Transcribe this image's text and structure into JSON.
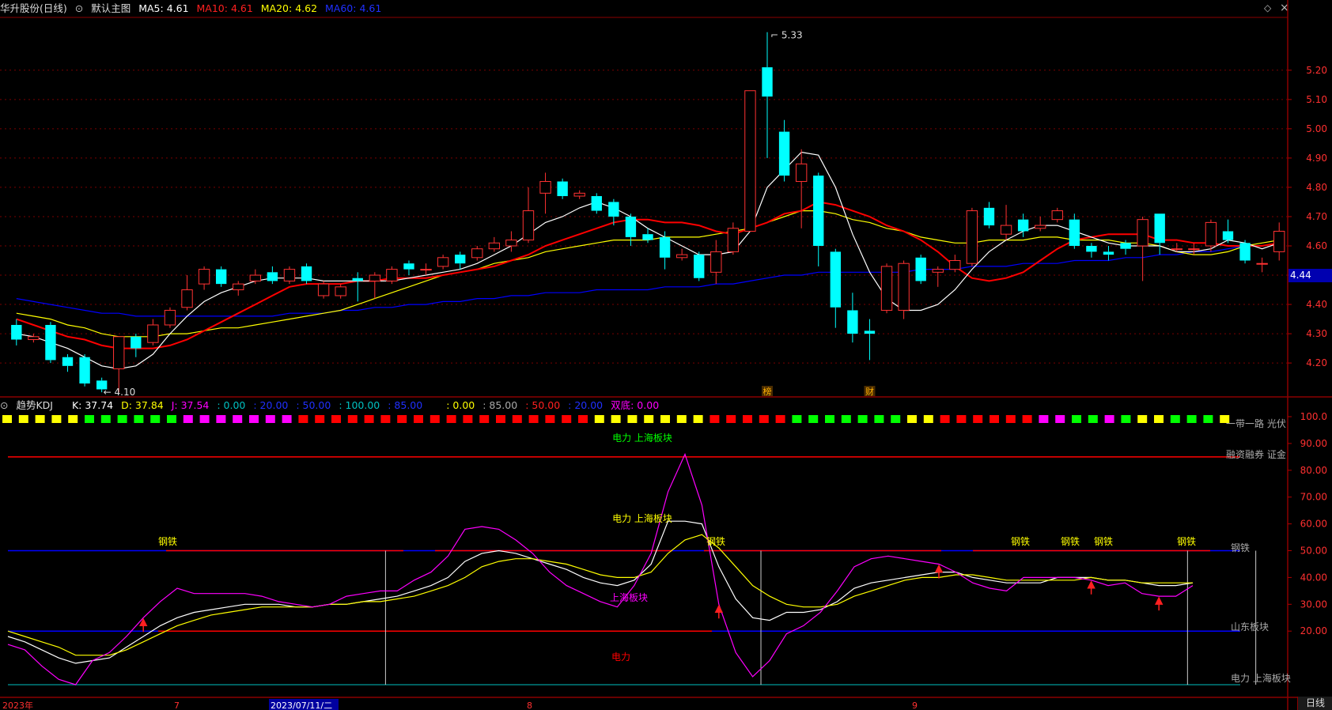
{
  "header": {
    "stock_name": "华升股份(日线)",
    "template_label": "默认主图",
    "ma5": "MA5: 4.61",
    "ma10": "MA10: 4.61",
    "ma20": "MA20: 4.62",
    "ma60": "MA60: 4.61"
  },
  "kdj_header": {
    "name": "趋势KDJ",
    "k": "K: 37.74",
    "d": "D: 37.84",
    "j": "J: 37.54",
    "v1": ": 0.00",
    "v2": ": 20.00",
    "v3": ": 50.00",
    "v4": ": 100.00",
    "v5": ": 85.00",
    "v6": ": 0.00",
    "v7": ": 85.00",
    "v8": ": 50.00",
    "v9": ": 20.00",
    "v10": "双底: 0.00"
  },
  "colors": {
    "up": "#ff3232",
    "down": "#00ffff",
    "ma5": "#ffffff",
    "ma10": "#ff0000",
    "ma20": "#ffff00",
    "ma60": "#0000ff",
    "k": "#ffffff",
    "d": "#ffff00",
    "j": "#ff00ff"
  },
  "price_badge": "4.44",
  "period_tab": "日线",
  "controls": {
    "diamond": "◇",
    "close": "×"
  },
  "chart_data": [
    {
      "type": "candlestick",
      "title": "华升股份(日线)",
      "y_ticks": [
        4.2,
        4.3,
        4.4,
        4.5,
        4.6,
        4.7,
        4.8,
        4.9,
        5.0,
        5.1,
        5.2
      ],
      "y_tick_labels": [
        "4.20",
        "4.30",
        "4.40",
        "4.50",
        "4.60",
        "4.70",
        "4.80",
        "4.90",
        "5.00",
        "5.10",
        "5.20"
      ],
      "ylim": [
        4.095,
        5.375
      ],
      "high_label": "5.33",
      "low_label": "4.10",
      "markers": [
        {
          "text": "榜",
          "index": 44
        },
        {
          "text": "财",
          "index": 50
        }
      ],
      "candles": [
        [
          4.33,
          4.28,
          4.35,
          4.26
        ],
        [
          4.28,
          4.29,
          4.3,
          4.27
        ],
        [
          4.33,
          4.21,
          4.34,
          4.2
        ],
        [
          4.22,
          4.19,
          4.23,
          4.17
        ],
        [
          4.22,
          4.13,
          4.23,
          4.12
        ],
        [
          4.14,
          4.11,
          4.15,
          4.1
        ],
        [
          4.18,
          4.29,
          4.29,
          4.1
        ],
        [
          4.29,
          4.25,
          4.3,
          4.22
        ],
        [
          4.27,
          4.33,
          4.35,
          4.26
        ],
        [
          4.33,
          4.38,
          4.39,
          4.32
        ],
        [
          4.39,
          4.45,
          4.5,
          4.38
        ],
        [
          4.47,
          4.52,
          4.53,
          4.45
        ],
        [
          4.52,
          4.47,
          4.53,
          4.46
        ],
        [
          4.45,
          4.47,
          4.48,
          4.43
        ],
        [
          4.48,
          4.5,
          4.52,
          4.47
        ],
        [
          4.51,
          4.48,
          4.53,
          4.47
        ],
        [
          4.48,
          4.52,
          4.53,
          4.47
        ],
        [
          4.53,
          4.48,
          4.54,
          4.47
        ],
        [
          4.43,
          4.47,
          4.48,
          4.42
        ],
        [
          4.43,
          4.46,
          4.47,
          4.42
        ],
        [
          4.49,
          4.48,
          4.51,
          4.41
        ],
        [
          4.48,
          4.5,
          4.51,
          4.42
        ],
        [
          4.48,
          4.52,
          4.53,
          4.47
        ],
        [
          4.54,
          4.52,
          4.55,
          4.5
        ],
        [
          4.52,
          4.52,
          4.54,
          4.5
        ],
        [
          4.53,
          4.56,
          4.57,
          4.52
        ],
        [
          4.57,
          4.54,
          4.58,
          4.52
        ],
        [
          4.56,
          4.59,
          4.6,
          4.55
        ],
        [
          4.59,
          4.61,
          4.63,
          4.58
        ],
        [
          4.6,
          4.62,
          4.65,
          4.58
        ],
        [
          4.62,
          4.72,
          4.8,
          4.61
        ],
        [
          4.78,
          4.82,
          4.85,
          4.71
        ],
        [
          4.82,
          4.77,
          4.83,
          4.76
        ],
        [
          4.77,
          4.78,
          4.79,
          4.76
        ],
        [
          4.77,
          4.72,
          4.78,
          4.71
        ],
        [
          4.75,
          4.7,
          4.76,
          4.67
        ],
        [
          4.7,
          4.63,
          4.71,
          4.6
        ],
        [
          4.64,
          4.62,
          4.66,
          4.61
        ],
        [
          4.63,
          4.56,
          4.65,
          4.52
        ],
        [
          4.56,
          4.57,
          4.59,
          4.55
        ],
        [
          4.57,
          4.49,
          4.58,
          4.48
        ],
        [
          4.51,
          4.58,
          4.62,
          4.47
        ],
        [
          4.58,
          4.66,
          4.68,
          4.57
        ],
        [
          4.65,
          5.13,
          5.13,
          4.65
        ],
        [
          5.21,
          5.11,
          5.33,
          4.9
        ],
        [
          4.99,
          4.84,
          5.03,
          4.82
        ],
        [
          4.82,
          4.88,
          4.93,
          4.66
        ],
        [
          4.84,
          4.6,
          4.85,
          4.53
        ],
        [
          4.58,
          4.39,
          4.59,
          4.32
        ],
        [
          4.38,
          4.3,
          4.44,
          4.27
        ],
        [
          4.31,
          4.3,
          4.35,
          4.21
        ],
        [
          4.38,
          4.53,
          4.54,
          4.37
        ],
        [
          4.38,
          4.54,
          4.55,
          4.35
        ],
        [
          4.56,
          4.48,
          4.57,
          4.47
        ],
        [
          4.51,
          4.52,
          4.53,
          4.46
        ],
        [
          4.52,
          4.55,
          4.57,
          4.51
        ],
        [
          4.54,
          4.72,
          4.73,
          4.53
        ],
        [
          4.73,
          4.67,
          4.75,
          4.66
        ],
        [
          4.64,
          4.67,
          4.74,
          4.62
        ],
        [
          4.69,
          4.65,
          4.71,
          4.63
        ],
        [
          4.66,
          4.67,
          4.7,
          4.65
        ],
        [
          4.69,
          4.72,
          4.73,
          4.68
        ],
        [
          4.69,
          4.6,
          4.71,
          4.59
        ],
        [
          4.6,
          4.58,
          4.61,
          4.56
        ],
        [
          4.58,
          4.57,
          4.6,
          4.55
        ],
        [
          4.61,
          4.59,
          4.62,
          4.57
        ],
        [
          4.6,
          4.69,
          4.7,
          4.48
        ],
        [
          4.71,
          4.61,
          4.71,
          4.57
        ],
        [
          4.59,
          4.59,
          4.61,
          4.58
        ],
        [
          4.59,
          4.59,
          4.61,
          4.57
        ],
        [
          4.6,
          4.68,
          4.69,
          4.58
        ],
        [
          4.65,
          4.62,
          4.69,
          4.61
        ],
        [
          4.61,
          4.55,
          4.62,
          4.54
        ],
        [
          4.54,
          4.54,
          4.56,
          4.51
        ],
        [
          4.58,
          4.65,
          4.68,
          4.55
        ]
      ],
      "ma5": [
        4.3,
        4.29,
        4.27,
        4.25,
        4.22,
        4.19,
        4.18,
        4.19,
        4.23,
        4.3,
        4.36,
        4.41,
        4.44,
        4.46,
        4.48,
        4.49,
        4.49,
        4.49,
        4.48,
        4.48,
        4.48,
        4.48,
        4.48,
        4.49,
        4.5,
        4.51,
        4.52,
        4.54,
        4.57,
        4.6,
        4.64,
        4.68,
        4.7,
        4.73,
        4.75,
        4.73,
        4.7,
        4.66,
        4.63,
        4.6,
        4.57,
        4.57,
        4.58,
        4.65,
        4.8,
        4.86,
        4.92,
        4.91,
        4.8,
        4.64,
        4.51,
        4.42,
        4.38,
        4.38,
        4.4,
        4.45,
        4.52,
        4.58,
        4.62,
        4.65,
        4.67,
        4.67,
        4.65,
        4.63,
        4.61,
        4.6,
        4.6,
        4.6,
        4.58,
        4.58,
        4.59,
        4.62,
        4.61,
        4.59,
        4.61
      ],
      "ma10": [
        4.35,
        4.33,
        4.31,
        4.29,
        4.28,
        4.26,
        4.25,
        4.25,
        4.25,
        4.26,
        4.28,
        4.31,
        4.34,
        4.37,
        4.4,
        4.43,
        4.46,
        4.47,
        4.47,
        4.47,
        4.48,
        4.48,
        4.49,
        4.49,
        4.49,
        4.5,
        4.51,
        4.52,
        4.53,
        4.55,
        4.57,
        4.6,
        4.62,
        4.64,
        4.66,
        4.68,
        4.69,
        4.69,
        4.68,
        4.68,
        4.67,
        4.65,
        4.64,
        4.66,
        4.68,
        4.71,
        4.72,
        4.75,
        4.74,
        4.72,
        4.7,
        4.67,
        4.65,
        4.62,
        4.58,
        4.53,
        4.49,
        4.48,
        4.49,
        4.51,
        4.55,
        4.59,
        4.62,
        4.63,
        4.64,
        4.64,
        4.64,
        4.62,
        4.62,
        4.61,
        4.61,
        4.6,
        4.6,
        4.6,
        4.61
      ],
      "ma20": [
        4.37,
        4.36,
        4.35,
        4.33,
        4.32,
        4.3,
        4.29,
        4.29,
        4.29,
        4.3,
        4.3,
        4.31,
        4.32,
        4.32,
        4.33,
        4.34,
        4.35,
        4.36,
        4.37,
        4.38,
        4.4,
        4.42,
        4.44,
        4.46,
        4.48,
        4.5,
        4.51,
        4.52,
        4.54,
        4.55,
        4.56,
        4.58,
        4.59,
        4.6,
        4.61,
        4.62,
        4.62,
        4.62,
        4.63,
        4.63,
        4.63,
        4.64,
        4.65,
        4.66,
        4.68,
        4.7,
        4.72,
        4.72,
        4.71,
        4.69,
        4.68,
        4.66,
        4.65,
        4.63,
        4.62,
        4.61,
        4.61,
        4.62,
        4.62,
        4.62,
        4.63,
        4.63,
        4.62,
        4.62,
        4.62,
        4.61,
        4.61,
        4.6,
        4.58,
        4.57,
        4.57,
        4.58,
        4.6,
        4.61,
        4.62
      ],
      "ma60": [
        4.42,
        4.41,
        4.4,
        4.39,
        4.38,
        4.37,
        4.37,
        4.36,
        4.36,
        4.36,
        4.36,
        4.36,
        4.36,
        4.36,
        4.36,
        4.36,
        4.37,
        4.37,
        4.37,
        4.38,
        4.38,
        4.39,
        4.39,
        4.4,
        4.4,
        4.41,
        4.41,
        4.42,
        4.42,
        4.43,
        4.43,
        4.44,
        4.44,
        4.44,
        4.45,
        4.45,
        4.45,
        4.45,
        4.46,
        4.46,
        4.46,
        4.47,
        4.47,
        4.48,
        4.49,
        4.5,
        4.5,
        4.51,
        4.51,
        4.51,
        4.51,
        4.51,
        4.51,
        4.52,
        4.52,
        4.52,
        4.53,
        4.53,
        4.53,
        4.54,
        4.54,
        4.54,
        4.55,
        4.55,
        4.55,
        4.56,
        4.56,
        4.57,
        4.57,
        4.58,
        4.58,
        4.59,
        4.6,
        4.6,
        4.61
      ]
    },
    {
      "type": "line",
      "title": "趋势KDJ",
      "y_ticks": [
        20,
        30,
        40,
        50,
        60,
        70,
        80,
        90,
        100
      ],
      "y_tick_labels": [
        "20.00",
        "30.00",
        "40.00",
        "50.00",
        "60.00",
        "70.00",
        "80.00",
        "90.00",
        "100.0"
      ],
      "ylim": [
        0,
        100
      ],
      "series": [
        {
          "name": "K",
          "values": [
            18,
            16,
            13,
            10,
            8,
            9,
            10,
            14,
            18,
            22,
            25,
            27,
            28,
            29,
            30,
            30,
            30,
            29,
            29,
            30,
            30,
            31,
            32,
            33,
            35,
            37,
            40,
            46,
            49,
            50,
            49,
            47,
            45,
            43,
            40,
            38,
            37,
            39,
            45,
            61,
            61,
            60,
            44,
            32,
            25,
            24,
            27,
            27,
            28,
            31,
            36,
            38,
            39,
            40,
            41,
            42,
            42,
            40,
            39,
            38,
            38,
            38,
            40,
            40,
            40,
            39,
            39,
            38,
            37,
            37,
            38
          ]
        },
        {
          "name": "D",
          "values": [
            20,
            18,
            16,
            14,
            11,
            11,
            11,
            13,
            16,
            19,
            22,
            24,
            26,
            27,
            28,
            29,
            29,
            29,
            29,
            30,
            30,
            31,
            31,
            32,
            33,
            35,
            37,
            40,
            44,
            46,
            47,
            47,
            46,
            45,
            43,
            41,
            40,
            40,
            42,
            49,
            54,
            56,
            51,
            44,
            37,
            33,
            30,
            29,
            29,
            30,
            33,
            35,
            37,
            39,
            40,
            40,
            41,
            41,
            40,
            39,
            39,
            39,
            39,
            39,
            40,
            39,
            39,
            38,
            38,
            38,
            38
          ]
        },
        {
          "name": "J",
          "values": [
            15,
            13,
            7,
            2,
            0,
            9,
            12,
            18,
            25,
            31,
            36,
            34,
            34,
            34,
            34,
            33,
            31,
            30,
            29,
            30,
            33,
            34,
            35,
            35,
            39,
            42,
            48,
            58,
            59,
            58,
            54,
            49,
            42,
            37,
            34,
            31,
            29,
            37,
            49,
            72,
            86,
            67,
            30,
            12,
            3,
            9,
            19,
            22,
            27,
            35,
            44,
            47,
            48,
            47,
            46,
            45,
            42,
            38,
            36,
            35,
            40,
            40,
            40,
            40,
            39,
            37,
            38,
            34,
            33,
            33,
            37
          ]
        }
      ],
      "reference_lines": [
        20,
        50,
        85
      ],
      "arrows_at": [
        8,
        42,
        55,
        64,
        68
      ],
      "labels": [
        {
          "text": "电力 上海板块",
          "color": "#00ff00",
          "row": "top"
        },
        {
          "text": "电力 上海板块",
          "color": "#ffff00"
        },
        {
          "text": "上海板块",
          "color": "#ff00ff"
        },
        {
          "text": "电力",
          "color": "#ff0000"
        },
        {
          "text": "钢铁",
          "color": "#ffff00"
        },
        {
          "text": "钢铁",
          "color": "#ffff00"
        },
        {
          "text": "钢铁",
          "color": "#ffff00"
        },
        {
          "text": "钢铁",
          "color": "#ffff00"
        },
        {
          "text": "钢铁",
          "color": "#ffff00"
        },
        {
          "text": "钢铁",
          "color": "#ffff00"
        }
      ],
      "right_labels": [
        "一带一路 光伏",
        "融资融券 证金",
        "钢铁",
        "山东板块",
        "电力 上海板块"
      ],
      "signal_colors": [
        "#ffff00",
        "#ffff00",
        "#ffff00",
        "#ffff00",
        "#ffff00",
        "#00ff00",
        "#00ff00",
        "#00ff00",
        "#00ff00",
        "#00ff00",
        "#00ff00",
        "#ff00ff",
        "#ff00ff",
        "#ff00ff",
        "#ff00ff",
        "#ff00ff",
        "#ff00ff",
        "#ff00ff",
        "#ff0000",
        "#ff0000",
        "#ff0000",
        "#ff0000",
        "#ff0000",
        "#ff0000",
        "#ff0000",
        "#ff0000",
        "#ff0000",
        "#ff0000",
        "#ff0000",
        "#ff0000",
        "#ff0000",
        "#ff0000",
        "#ff0000",
        "#ff0000",
        "#ff0000",
        "#ff0000",
        "#ffff00",
        "#ffff00",
        "#ffff00",
        "#ffff00",
        "#ffff00",
        "#ffff00",
        "#ffff00",
        "#ff0000",
        "#ff0000",
        "#ff0000",
        "#ff0000",
        "#ff0000",
        "#00ff00",
        "#00ff00",
        "#00ff00",
        "#00ff00",
        "#00ff00",
        "#00ff00",
        "#00ff00",
        "#ffff00",
        "#ffff00",
        "#ff0000",
        "#ff0000",
        "#ff0000",
        "#ff0000",
        "#ff0000",
        "#ff0000",
        "#ff00ff",
        "#ff00ff",
        "#00ff00",
        "#00ff00",
        "#ff00ff",
        "#00ff00",
        "#ffff00",
        "#ffff00",
        "#00ff00",
        "#00ff00",
        "#00ff00",
        "#ffff00"
      ]
    }
  ],
  "x_axis": [
    "2023年",
    "7",
    "2023/07/11/二",
    "8",
    "9"
  ]
}
